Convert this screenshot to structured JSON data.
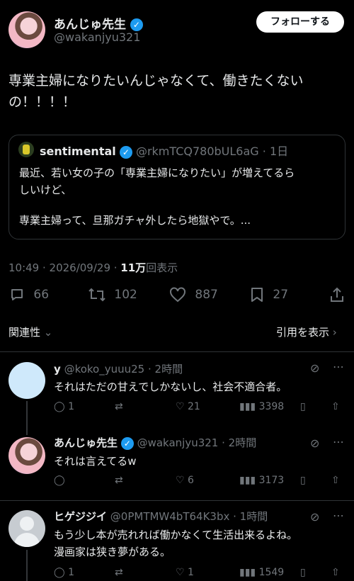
{
  "main_post": {
    "display_name": "あんじゅ先生",
    "handle": "@wakanjyu321",
    "follow_label": "フォローする",
    "text_line1": "専業主婦になりたいんじゃなくて、働きたくない",
    "text_line2": "の！！！！",
    "quoted": {
      "display_name": "sentimental",
      "handle": "@rkmTCQ780bUL6aG",
      "time": "1日",
      "line1": "最近、若い女の子の「専業主婦になりたい」が増えてるら",
      "line2": "しいけど、",
      "line3": "専業主婦って、旦那ガチャ外したら地獄やで。..."
    },
    "timestamp": "10:49 · 2026/09/29 · ",
    "views_count": "11万",
    "views_label": "回表示",
    "replies": "66",
    "reposts": "102",
    "likes": "887",
    "bookmarks": "27",
    "related_label": "関連性",
    "quotes_link": "引用を表示"
  },
  "replies": [
    {
      "display_name": "y",
      "handle": "@koko_yuuu25",
      "time": "2時間",
      "text_lines": [
        "それはただの甘えでしかないし、社会不適合者。"
      ],
      "replies": "1",
      "reposts": "",
      "likes": "21",
      "views": "3398"
    },
    {
      "display_name": "あんじゅ先生",
      "handle": "@wakanjyu321",
      "time": "2時間",
      "text_lines": [
        "それは言えてるw"
      ],
      "replies": "",
      "reposts": "",
      "likes": "6",
      "views": "3173"
    },
    {
      "display_name": "ヒゲジジイ",
      "handle": "@0PMTMW4bT64K3bx",
      "time": "1時間",
      "text_lines": [
        "もう少し本が売れれば働かなくて生活出来るよね。",
        "漫画家は狭き夢がある。"
      ],
      "replies": "1",
      "reposts": "",
      "likes": "1",
      "views": "1549"
    }
  ],
  "icons": {
    "reply": "reply-icon",
    "repost": "repost-icon",
    "like": "like-icon",
    "bookmark": "bookmark-icon",
    "share": "share-icon",
    "views": "views-icon",
    "grok": "grok-icon",
    "more": "more-icon"
  }
}
